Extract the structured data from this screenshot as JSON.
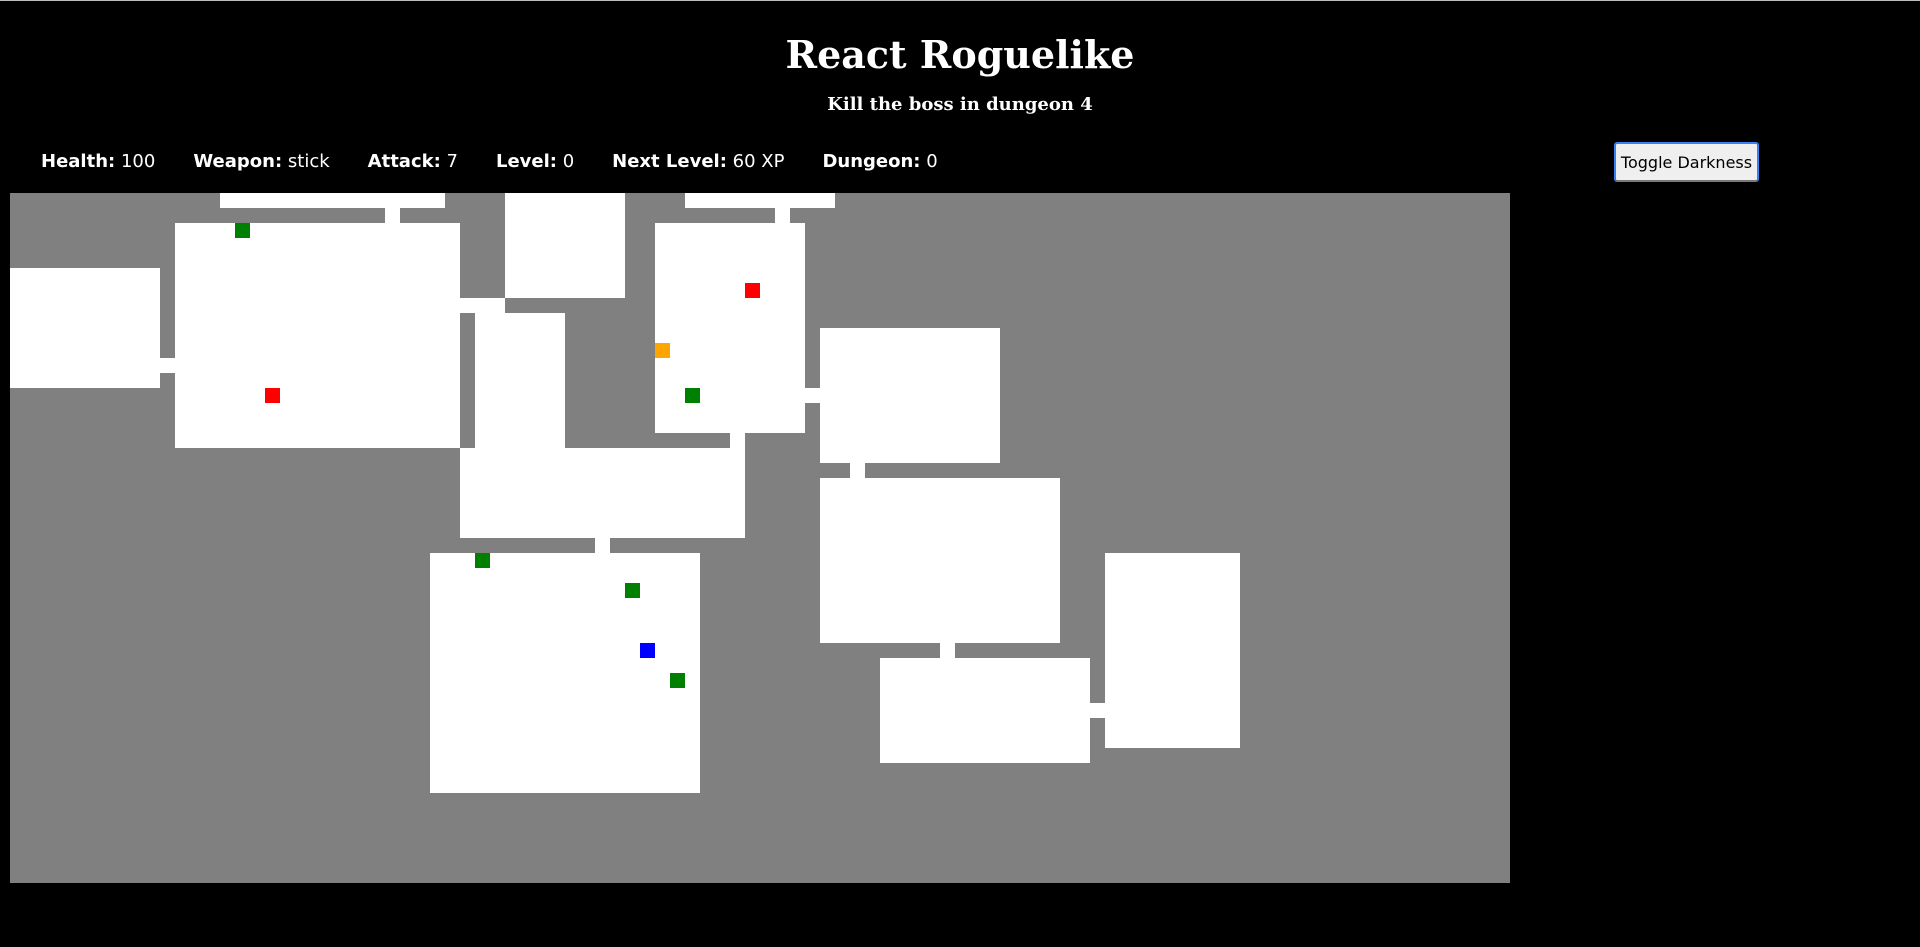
{
  "header": {
    "title": "React Roguelike",
    "subtitle": "Kill the boss in dungeon 4"
  },
  "stats": [
    {
      "label": "Health:",
      "value": "100"
    },
    {
      "label": "Weapon:",
      "value": "stick"
    },
    {
      "label": "Attack:",
      "value": "7"
    },
    {
      "label": "Level:",
      "value": "0"
    },
    {
      "label": "Next Level:",
      "value": "60 XP"
    },
    {
      "label": "Dungeon:",
      "value": "0"
    }
  ],
  "controls": {
    "toggle_label": "Toggle Darkness"
  },
  "map": {
    "wall_color": "#808080",
    "floor_color": "#ffffff",
    "entity_colors": {
      "health": "#008000",
      "enemy": "#ff0000",
      "weapon": "#ffa500",
      "player": "#0000ff"
    }
  }
}
